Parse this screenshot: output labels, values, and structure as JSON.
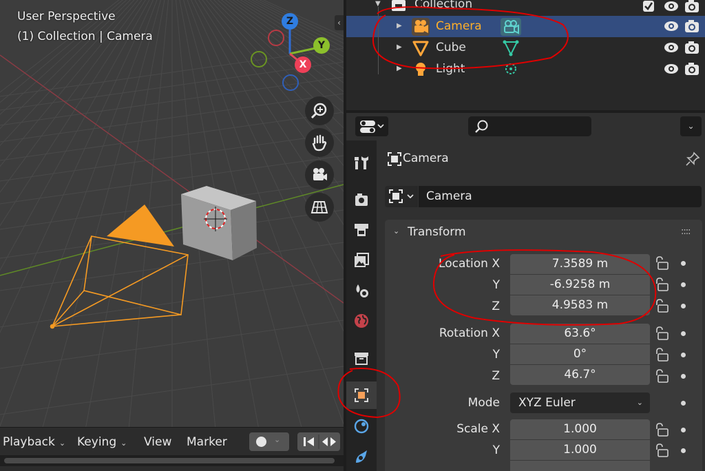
{
  "viewport": {
    "title": "User Perspective",
    "subtitle": "(1) Collection | Camera",
    "gizmo": {
      "z": "Z",
      "y": "Y",
      "x": "X"
    },
    "nav_icons": [
      "zoom-icon",
      "hand-pan-icon",
      "camera-view-icon",
      "grid-ortho-icon"
    ],
    "side_toggle": "‹"
  },
  "timeline": {
    "menus": [
      {
        "label": "Playback",
        "has_dropdown": true
      },
      {
        "label": "Keying",
        "has_dropdown": true
      },
      {
        "label": "View",
        "has_dropdown": false
      },
      {
        "label": "Marker",
        "has_dropdown": false
      }
    ],
    "dropdown_glyph": "⌄"
  },
  "outliner": {
    "collection": "Collection",
    "items": [
      {
        "label": "Camera",
        "icon": "camera-object-icon",
        "data_icon": "camera-data-icon",
        "selected": true
      },
      {
        "label": "Cube",
        "icon": "mesh-object-icon",
        "data_icon": "mesh-data-icon",
        "selected": false
      },
      {
        "label": "Light",
        "icon": "light-object-icon",
        "data_icon": "light-data-icon",
        "selected": false
      }
    ]
  },
  "properties": {
    "breadcrumb": "Camera",
    "object_name": "Camera",
    "panel_title": "Transform",
    "location": {
      "label": "Location X",
      "x": "7.3589 m",
      "y": "-6.9258 m",
      "z": "4.9583 m"
    },
    "rotation": {
      "label": "Rotation X",
      "x": "63.6°",
      "y": "0°",
      "z": "46.7°"
    },
    "axis_y": "Y",
    "axis_z": "Z",
    "mode": {
      "label": "Mode",
      "value": "XYZ Euler"
    },
    "scale": {
      "label": "Scale X",
      "x": "1.000",
      "y": "1.000"
    }
  },
  "colors": {
    "selection": "#334d80",
    "active_text": "#ffaf29",
    "annotation": "#e00000",
    "object_orange": "#f59a23"
  }
}
